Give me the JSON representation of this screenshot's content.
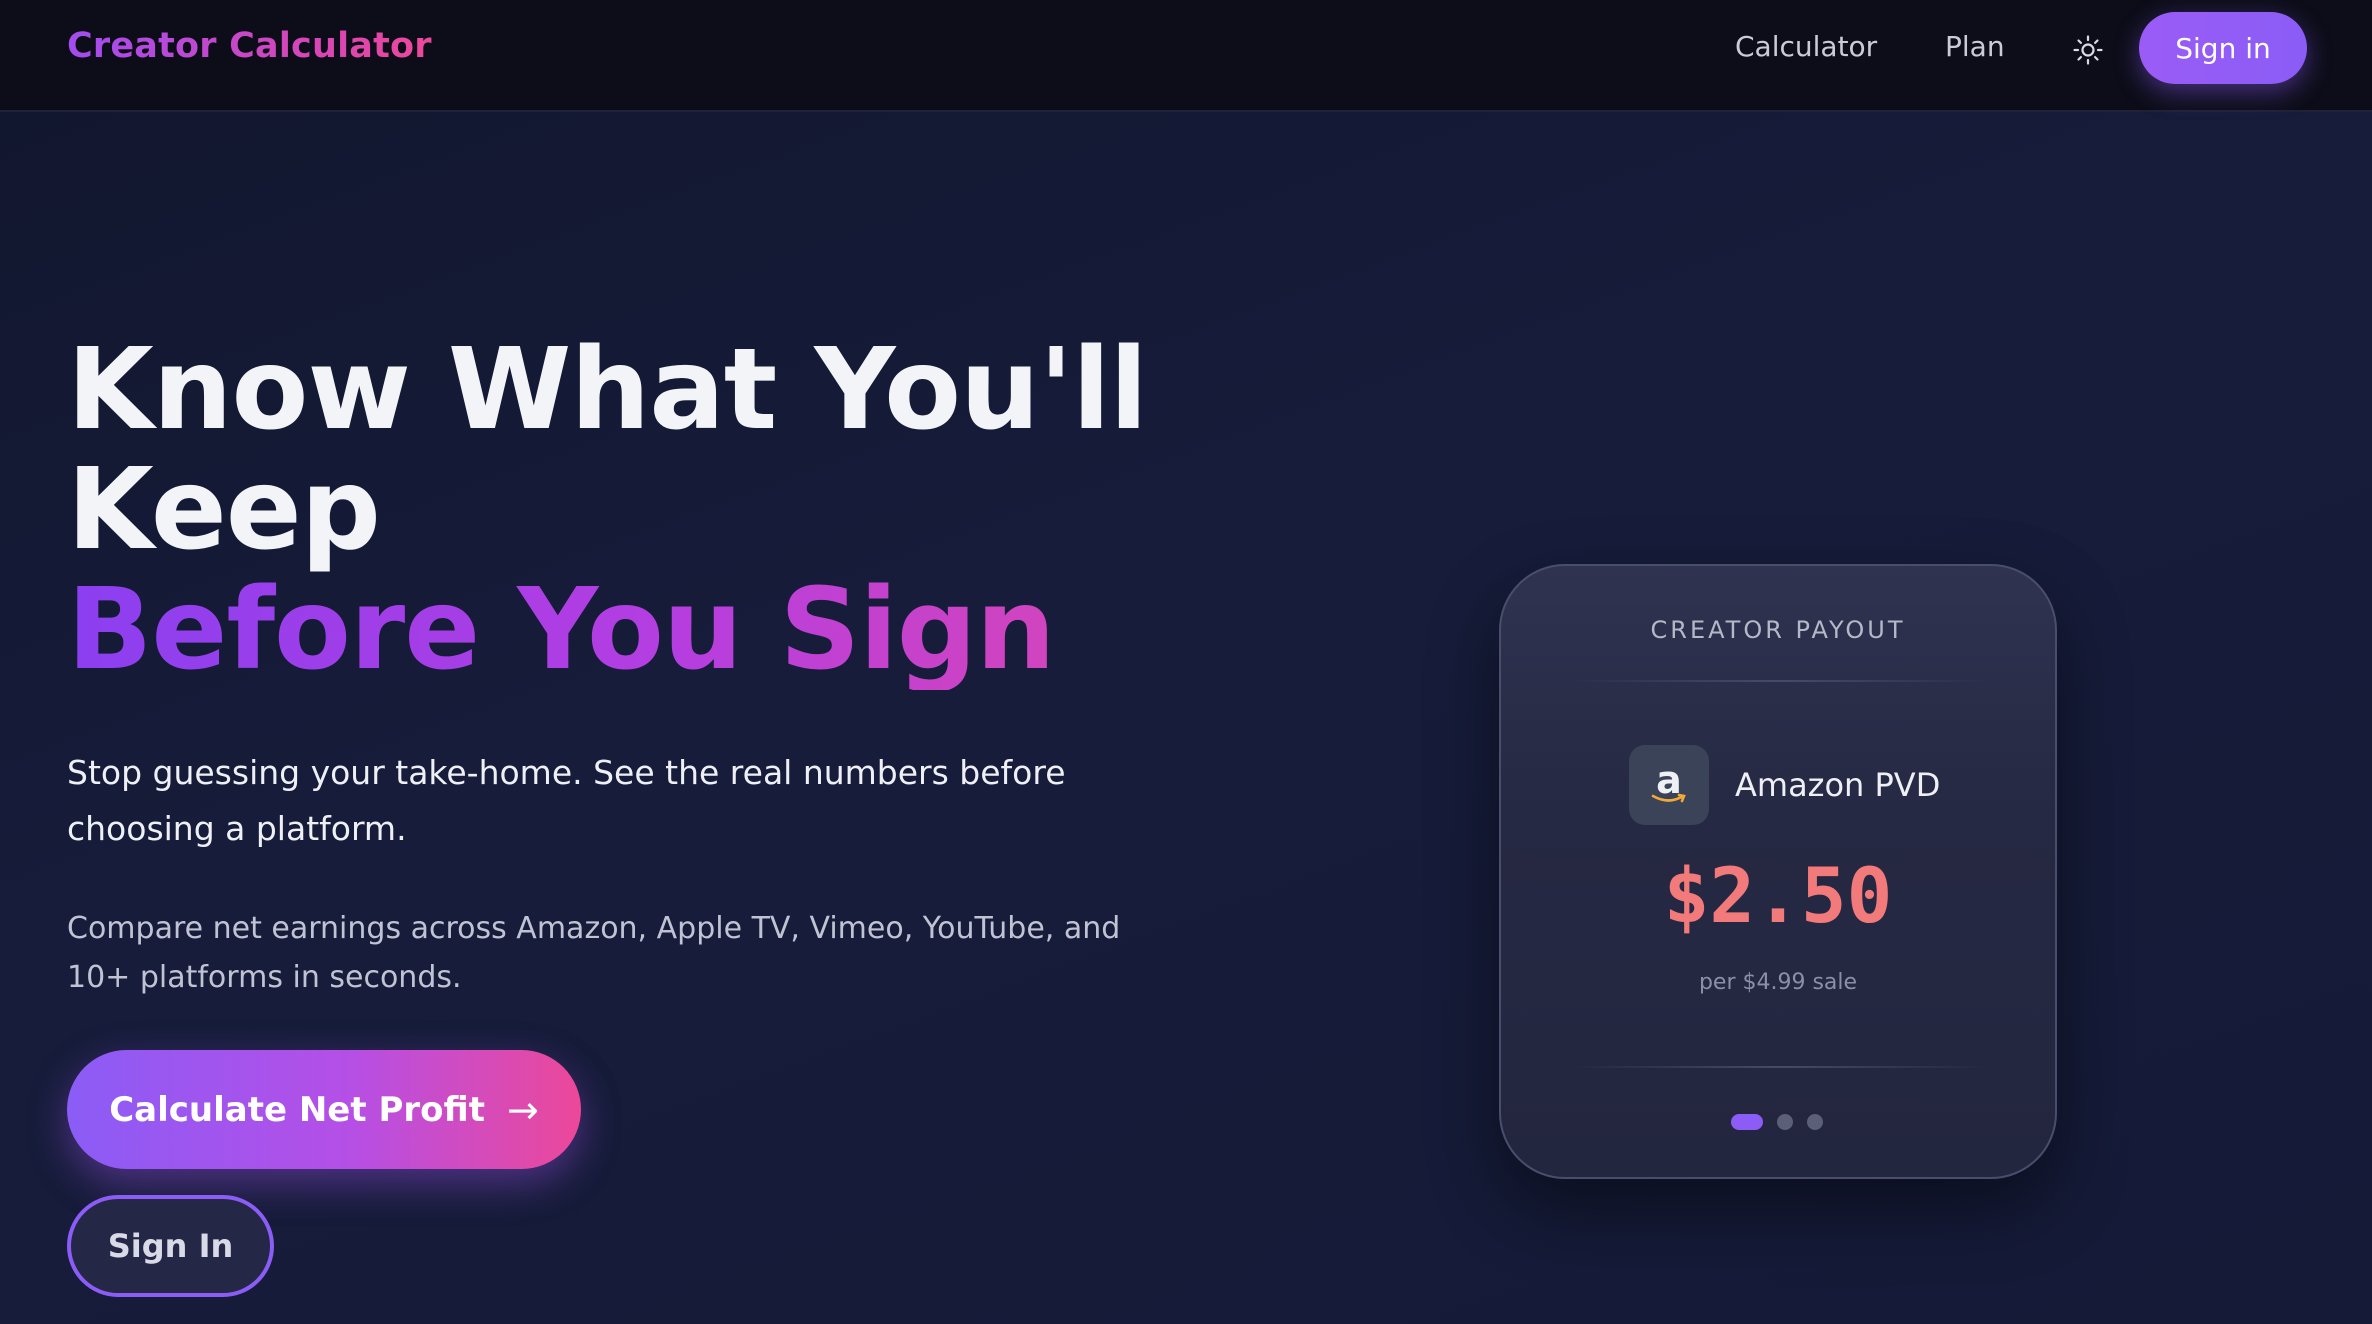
{
  "nav": {
    "brand": "Creator Calculator",
    "links": [
      "Calculator",
      "Plan"
    ],
    "theme_icon": "sun-icon",
    "signin_label": "Sign in"
  },
  "hero": {
    "title_line1": "Know What You'll Keep",
    "title_line2": "Before You Sign",
    "subtitle": "Stop guessing your take-home. See the real numbers before choosing a platform.",
    "description": "Compare net earnings across Amazon, Apple TV, Vimeo, YouTube, and 10+ platforms in seconds.",
    "cta_label": "Calculate Net Profit",
    "cta_icon": "arrow-right-icon",
    "secondary_label": "Sign In"
  },
  "card": {
    "label": "CREATOR PAYOUT",
    "platform": "Amazon PVD",
    "platform_icon": "amazon-logo-icon",
    "amount": "$2.50",
    "amount_caption": "per $4.99 sale",
    "carousel_count": 3,
    "carousel_active": 1
  },
  "colors": {
    "accent": "#8b5cf6",
    "pink": "#ec4899",
    "payout_red": "#f27a7a",
    "background": "#151a37"
  }
}
